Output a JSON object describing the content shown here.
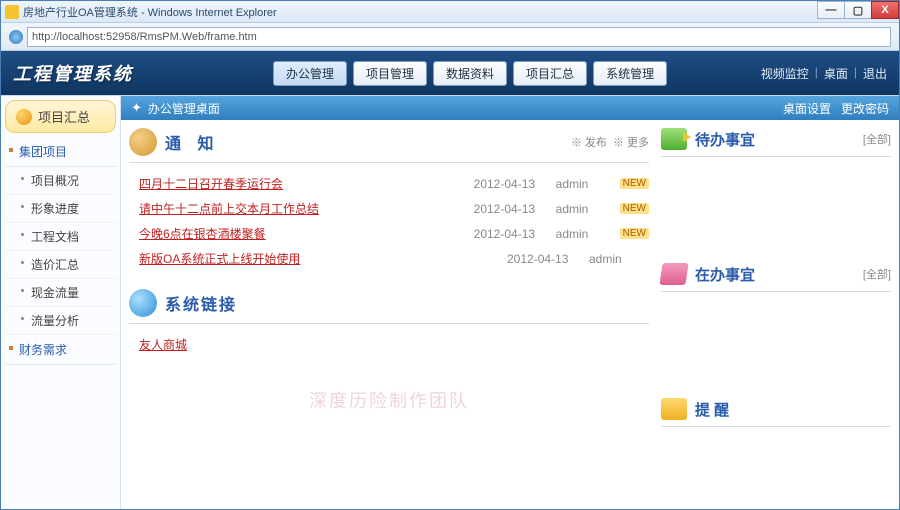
{
  "window": {
    "title": "房地产行业OA管理系统 - Windows Internet Explorer",
    "url": "http://localhost:52958/RmsPM.Web/frame.htm",
    "min": "—",
    "max": "▢",
    "close": "X"
  },
  "topnav": {
    "brand": "工程管理系统",
    "tabs": [
      "办公管理",
      "项目管理",
      "数据资料",
      "项目汇总",
      "系统管理"
    ],
    "links": [
      "视频监控",
      "桌面",
      "退出"
    ]
  },
  "crumb": {
    "star": "✦",
    "path": "办公管理桌面",
    "right": [
      "桌面设置",
      "更改密码"
    ]
  },
  "sidebar": {
    "top": "项目汇总",
    "groups": [
      {
        "label": "集团项目",
        "items": [
          "项目概况",
          "形象进度",
          "工程文档",
          "造价汇总",
          "现金流量",
          "流量分析"
        ]
      },
      {
        "label": "财务需求",
        "items": []
      }
    ]
  },
  "notice": {
    "title": "通 知",
    "act_publish": "※ 发布",
    "act_more": "※ 更多",
    "rows": [
      {
        "text": "四月十二日召开春季运行会",
        "date": "2012-04-13",
        "user": "admin",
        "tag": "NEW"
      },
      {
        "text": "请中午十二点前上交本月工作总结",
        "date": "2012-04-13",
        "user": "admin",
        "tag": "NEW"
      },
      {
        "text": "今晚6点在银杏酒楼聚餐",
        "date": "2012-04-13",
        "user": "admin",
        "tag": "NEW"
      },
      {
        "text": "新版OA系统正式上线开始使用",
        "date": "2012-04-13",
        "user": "admin",
        "tag": ""
      }
    ]
  },
  "syslinks": {
    "title": "系统链接",
    "rows": [
      {
        "text": "友人商城"
      }
    ]
  },
  "watermark": "深度历险制作团队",
  "cards": {
    "todo": {
      "title": "待办事宜",
      "all": "[全部]"
    },
    "doing": {
      "title": "在办事宜",
      "all": "[全部]"
    },
    "remind": {
      "title": "提 醒",
      "all": ""
    }
  }
}
